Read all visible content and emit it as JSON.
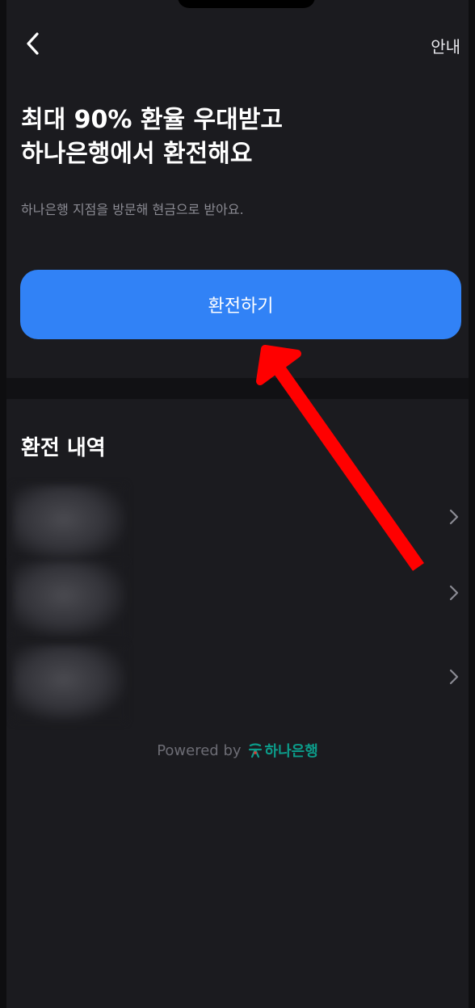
{
  "header": {
    "guide_label": "안내"
  },
  "hero": {
    "title": "최대 90% 환율 우대받고\n하나은행에서 환전해요",
    "subtitle": "하나은행 지점을 방문해 현금으로 받아요."
  },
  "primary_button": {
    "label": "환전하기",
    "color": "#3182f6"
  },
  "history": {
    "title": "환전 내역",
    "items": [
      {
        "blurred": true
      },
      {
        "blurred": true
      },
      {
        "blurred": true
      }
    ]
  },
  "footer": {
    "powered_by": "Powered by",
    "bank_name": "하나은행",
    "bank_color": "#0c9c8a"
  },
  "annotation": {
    "arrow_color": "#ff0000"
  }
}
